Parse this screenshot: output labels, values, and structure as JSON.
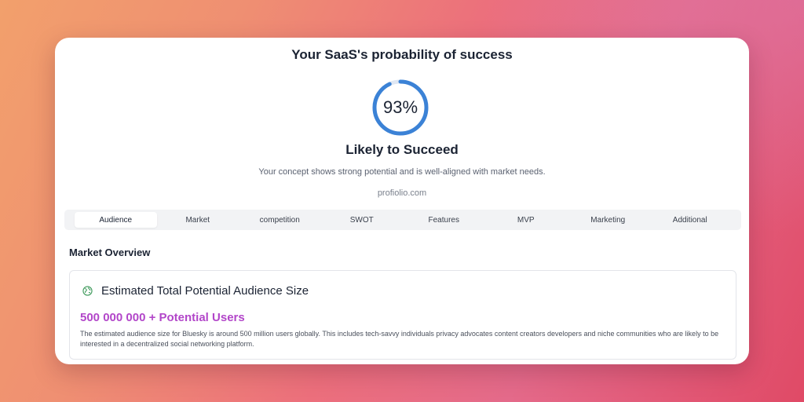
{
  "header": {
    "title": "Your SaaS's probability of success"
  },
  "score": {
    "value": 93,
    "label": "93%",
    "color": "#3b82d6",
    "track_color": "#dfe7f3"
  },
  "verdict": "Likely to Succeed",
  "description": "Your concept shows strong potential and is well-aligned with market needs.",
  "site": "profiolio.com",
  "tabs": [
    {
      "label": "Audience",
      "active": true
    },
    {
      "label": "Market"
    },
    {
      "label": "competition"
    },
    {
      "label": "SWOT"
    },
    {
      "label": "Features"
    },
    {
      "label": "MVP"
    },
    {
      "label": "Marketing"
    },
    {
      "label": "Additional"
    }
  ],
  "section": {
    "title": "Market Overview"
  },
  "panel": {
    "icon": "globe-icon",
    "title": "Estimated Total Potential Audience Size",
    "audience": "500 000 000 + Potential Users",
    "audience_color": "#b246c9",
    "description": "The estimated audience size for Bluesky is around 500 million users globally. This includes tech-savvy individuals privacy advocates content creators developers and niche communities who are likely to be interested in a decentralized social networking platform."
  }
}
